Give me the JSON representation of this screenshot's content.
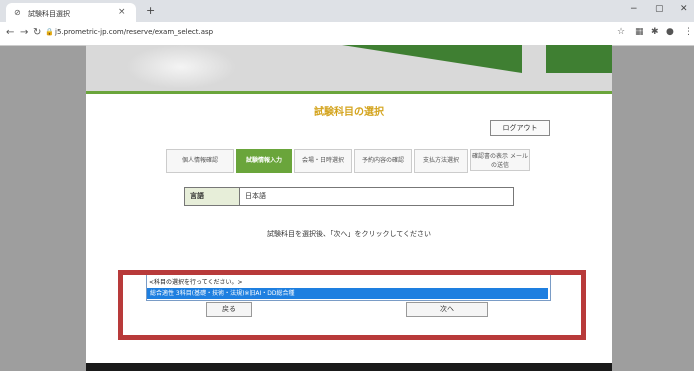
{
  "browser": {
    "tab_title": "試験科目選択",
    "url": "j5.prometric-jp.com/reserve/exam_select.asp",
    "new_tab": "+",
    "close_tab": "×",
    "minimize": "−",
    "maximize": "▢",
    "close_window": "✕"
  },
  "page": {
    "title": "試験科目の選択",
    "logout_label": "ログアウト",
    "steps": [
      {
        "label": "個人情報確認",
        "active": false
      },
      {
        "label": "試験情報入力",
        "active": true
      },
      {
        "label": "会場・日時選択",
        "active": false
      },
      {
        "label": "予約内容の確認",
        "active": false
      },
      {
        "label": "支払方法選択",
        "active": false
      },
      {
        "label": "確認書の表示 メールの送信",
        "active": false
      }
    ],
    "language_label": "言語",
    "language_value": "日本語",
    "instruction": "試験科目を選択後、「次へ」をクリックしてください",
    "dropdown": {
      "option_placeholder": "<科目の選択を行ってください。>",
      "option_selected": "総合適性 3科目(基礎・技術・法規)※旧AI・DD総合種"
    },
    "back_label": "戻る",
    "next_label": "次へ"
  },
  "colors": {
    "accent_green": "#6aa53b",
    "title_gold": "#d4a41e",
    "highlight_blue": "#1e7fe0",
    "annotation_red": "#b83a3a"
  }
}
